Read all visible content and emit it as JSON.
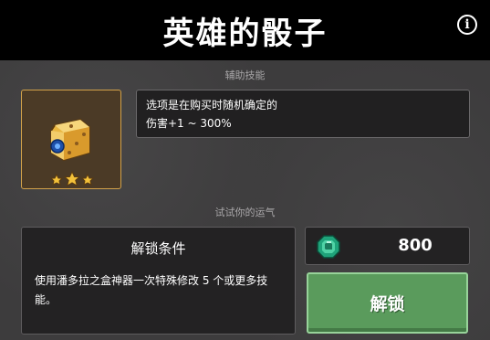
{
  "header": {
    "title": "英雄的骰子",
    "info_icon": "info-icon"
  },
  "sections": {
    "skill_label": "辅助技能",
    "luck_label": "试试你的运气"
  },
  "item": {
    "icon": "golden-die-icon",
    "rating": 3,
    "rating_max": 3,
    "description_lines": [
      "选项是在购买时随机确定的",
      "伤害+1 ~ 300%"
    ]
  },
  "unlock_condition": {
    "title": "解锁条件",
    "text": "使用潘多拉之盒神器一次特殊修改 5 个或更多技能。"
  },
  "price": {
    "icon": "gem-icon",
    "amount": "800"
  },
  "unlock_button": {
    "label": "解锁",
    "color": "#5a9b5c"
  }
}
